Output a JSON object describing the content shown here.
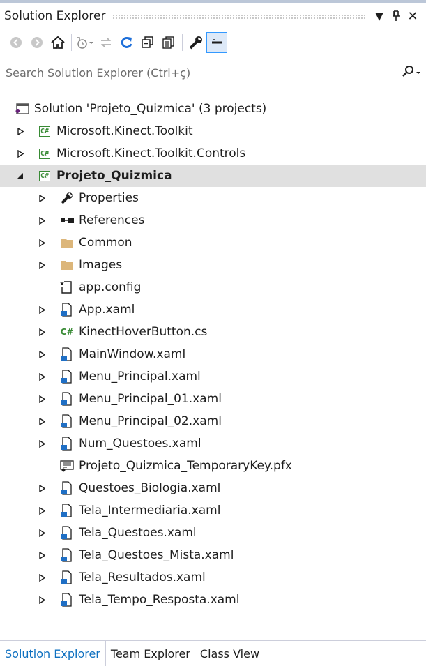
{
  "window": {
    "title": "Solution Explorer",
    "menu_arrow": "▼",
    "pin": "⊥",
    "close": "✕"
  },
  "toolbar": {
    "buttons": [
      "back-icon",
      "forward-icon",
      "home-icon",
      "pending-changes-icon",
      "sync-icon",
      "refresh-icon",
      "collapse-all-icon",
      "show-all-files-icon",
      "properties-icon",
      "preview-selected-icon"
    ]
  },
  "search": {
    "placeholder": "Search Solution Explorer (Ctrl+ç)",
    "value": ""
  },
  "tree": {
    "solution": "Solution 'Projeto_Quizmica' (3 projects)",
    "projects": [
      {
        "label": "Microsoft.Kinect.Toolkit"
      },
      {
        "label": "Microsoft.Kinect.Toolkit.Controls"
      },
      {
        "label": "Projeto_Quizmica"
      }
    ],
    "children": [
      {
        "label": "Properties"
      },
      {
        "label": "References"
      },
      {
        "label": "Common"
      },
      {
        "label": "Images"
      },
      {
        "label": "app.config"
      },
      {
        "label": "App.xaml"
      },
      {
        "label": "KinectHoverButton.cs"
      },
      {
        "label": "MainWindow.xaml"
      },
      {
        "label": "Menu_Principal.xaml"
      },
      {
        "label": "Menu_Principal_01.xaml"
      },
      {
        "label": "Menu_Principal_02.xaml"
      },
      {
        "label": "Num_Questoes.xaml"
      },
      {
        "label": "Projeto_Quizmica_TemporaryKey.pfx"
      },
      {
        "label": "Questoes_Biologia.xaml"
      },
      {
        "label": "Tela_Intermediaria.xaml"
      },
      {
        "label": "Tela_Questoes.xaml"
      },
      {
        "label": "Tela_Questoes_Mista.xaml"
      },
      {
        "label": "Tela_Resultados.xaml"
      },
      {
        "label": "Tela_Tempo_Resposta.xaml"
      }
    ]
  },
  "cs_badge": "C#",
  "tabs": [
    "Solution Explorer",
    "Team Explorer",
    "Class View"
  ],
  "colors": {
    "accent": "#0e70c0",
    "selection": "#e0e0e0",
    "cs_green": "#388a34",
    "folder": "#dcb67a"
  }
}
